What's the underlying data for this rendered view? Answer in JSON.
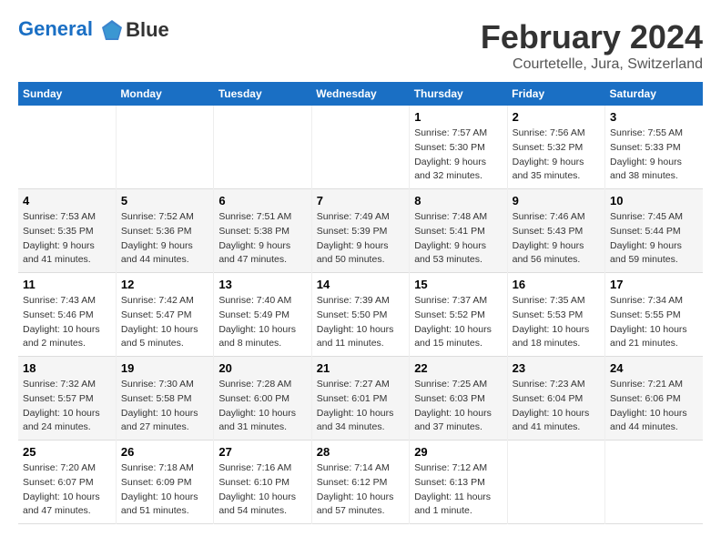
{
  "logo": {
    "line1": "General",
    "line2": "Blue"
  },
  "title": "February 2024",
  "subtitle": "Courtetelle, Jura, Switzerland",
  "days_of_week": [
    "Sunday",
    "Monday",
    "Tuesday",
    "Wednesday",
    "Thursday",
    "Friday",
    "Saturday"
  ],
  "weeks": [
    [
      {
        "day": "",
        "info": ""
      },
      {
        "day": "",
        "info": ""
      },
      {
        "day": "",
        "info": ""
      },
      {
        "day": "",
        "info": ""
      },
      {
        "day": "1",
        "info": "Sunrise: 7:57 AM\nSunset: 5:30 PM\nDaylight: 9 hours and 32 minutes."
      },
      {
        "day": "2",
        "info": "Sunrise: 7:56 AM\nSunset: 5:32 PM\nDaylight: 9 hours and 35 minutes."
      },
      {
        "day": "3",
        "info": "Sunrise: 7:55 AM\nSunset: 5:33 PM\nDaylight: 9 hours and 38 minutes."
      }
    ],
    [
      {
        "day": "4",
        "info": "Sunrise: 7:53 AM\nSunset: 5:35 PM\nDaylight: 9 hours and 41 minutes."
      },
      {
        "day": "5",
        "info": "Sunrise: 7:52 AM\nSunset: 5:36 PM\nDaylight: 9 hours and 44 minutes."
      },
      {
        "day": "6",
        "info": "Sunrise: 7:51 AM\nSunset: 5:38 PM\nDaylight: 9 hours and 47 minutes."
      },
      {
        "day": "7",
        "info": "Sunrise: 7:49 AM\nSunset: 5:39 PM\nDaylight: 9 hours and 50 minutes."
      },
      {
        "day": "8",
        "info": "Sunrise: 7:48 AM\nSunset: 5:41 PM\nDaylight: 9 hours and 53 minutes."
      },
      {
        "day": "9",
        "info": "Sunrise: 7:46 AM\nSunset: 5:43 PM\nDaylight: 9 hours and 56 minutes."
      },
      {
        "day": "10",
        "info": "Sunrise: 7:45 AM\nSunset: 5:44 PM\nDaylight: 9 hours and 59 minutes."
      }
    ],
    [
      {
        "day": "11",
        "info": "Sunrise: 7:43 AM\nSunset: 5:46 PM\nDaylight: 10 hours and 2 minutes."
      },
      {
        "day": "12",
        "info": "Sunrise: 7:42 AM\nSunset: 5:47 PM\nDaylight: 10 hours and 5 minutes."
      },
      {
        "day": "13",
        "info": "Sunrise: 7:40 AM\nSunset: 5:49 PM\nDaylight: 10 hours and 8 minutes."
      },
      {
        "day": "14",
        "info": "Sunrise: 7:39 AM\nSunset: 5:50 PM\nDaylight: 10 hours and 11 minutes."
      },
      {
        "day": "15",
        "info": "Sunrise: 7:37 AM\nSunset: 5:52 PM\nDaylight: 10 hours and 15 minutes."
      },
      {
        "day": "16",
        "info": "Sunrise: 7:35 AM\nSunset: 5:53 PM\nDaylight: 10 hours and 18 minutes."
      },
      {
        "day": "17",
        "info": "Sunrise: 7:34 AM\nSunset: 5:55 PM\nDaylight: 10 hours and 21 minutes."
      }
    ],
    [
      {
        "day": "18",
        "info": "Sunrise: 7:32 AM\nSunset: 5:57 PM\nDaylight: 10 hours and 24 minutes."
      },
      {
        "day": "19",
        "info": "Sunrise: 7:30 AM\nSunset: 5:58 PM\nDaylight: 10 hours and 27 minutes."
      },
      {
        "day": "20",
        "info": "Sunrise: 7:28 AM\nSunset: 6:00 PM\nDaylight: 10 hours and 31 minutes."
      },
      {
        "day": "21",
        "info": "Sunrise: 7:27 AM\nSunset: 6:01 PM\nDaylight: 10 hours and 34 minutes."
      },
      {
        "day": "22",
        "info": "Sunrise: 7:25 AM\nSunset: 6:03 PM\nDaylight: 10 hours and 37 minutes."
      },
      {
        "day": "23",
        "info": "Sunrise: 7:23 AM\nSunset: 6:04 PM\nDaylight: 10 hours and 41 minutes."
      },
      {
        "day": "24",
        "info": "Sunrise: 7:21 AM\nSunset: 6:06 PM\nDaylight: 10 hours and 44 minutes."
      }
    ],
    [
      {
        "day": "25",
        "info": "Sunrise: 7:20 AM\nSunset: 6:07 PM\nDaylight: 10 hours and 47 minutes."
      },
      {
        "day": "26",
        "info": "Sunrise: 7:18 AM\nSunset: 6:09 PM\nDaylight: 10 hours and 51 minutes."
      },
      {
        "day": "27",
        "info": "Sunrise: 7:16 AM\nSunset: 6:10 PM\nDaylight: 10 hours and 54 minutes."
      },
      {
        "day": "28",
        "info": "Sunrise: 7:14 AM\nSunset: 6:12 PM\nDaylight: 10 hours and 57 minutes."
      },
      {
        "day": "29",
        "info": "Sunrise: 7:12 AM\nSunset: 6:13 PM\nDaylight: 11 hours and 1 minute."
      },
      {
        "day": "",
        "info": ""
      },
      {
        "day": "",
        "info": ""
      }
    ]
  ]
}
